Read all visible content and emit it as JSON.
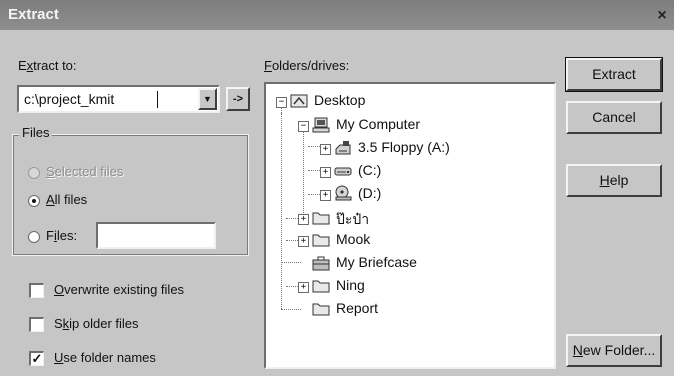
{
  "window": {
    "title": "Extract",
    "close_glyph": "×"
  },
  "extract_to": {
    "label_prefix": "E",
    "label_hot": "x",
    "label_rest": "tract to:",
    "value": "c:\\project_kmit",
    "dropdown_glyph": "▼",
    "go_glyph": "->"
  },
  "files_group": {
    "caption": "Files",
    "options": [
      {
        "hot": "S",
        "rest": "elected files",
        "checked": false,
        "disabled": true
      },
      {
        "hot": "A",
        "rest": "ll files",
        "checked": true,
        "disabled": false
      },
      {
        "hot": "i",
        "pre": "F",
        "rest": "les:",
        "checked": false,
        "disabled": false
      }
    ],
    "files_value": ""
  },
  "checkboxes": [
    {
      "hot": "O",
      "rest": "verwrite existing files",
      "checked": false
    },
    {
      "pre": "S",
      "hot": "k",
      "rest": "ip older files",
      "checked": false
    },
    {
      "hot": "U",
      "rest": "se folder names",
      "checked": true
    }
  ],
  "folders": {
    "label_hot": "F",
    "label_rest": "olders/drives:",
    "nodes": [
      {
        "label": "Desktop",
        "icon": "desktop-icon",
        "expander": "−"
      },
      {
        "label": "My Computer",
        "icon": "computer-icon",
        "expander": "−"
      },
      {
        "label": "3.5 Floppy (A:)",
        "icon": "floppy-drive-icon",
        "expander": "+"
      },
      {
        "label": "(C:)",
        "icon": "hard-drive-icon",
        "expander": "+"
      },
      {
        "label": "(D:)",
        "icon": "cd-drive-icon",
        "expander": "+"
      },
      {
        "label": "ป๊ะป๋า",
        "icon": "folder-icon",
        "expander": "+"
      },
      {
        "label": "Mook",
        "icon": "folder-icon",
        "expander": "+"
      },
      {
        "label": "My Briefcase",
        "icon": "briefcase-icon",
        "expander": ""
      },
      {
        "label": "Ning",
        "icon": "folder-icon",
        "expander": "+"
      },
      {
        "label": "Report",
        "icon": "folder-icon",
        "expander": ""
      }
    ]
  },
  "buttons": {
    "extract": "Extract",
    "cancel": "Cancel",
    "help_hot": "H",
    "help_rest": "elp",
    "new_folder_hot": "N",
    "new_folder_rest": "ew Folder..."
  }
}
